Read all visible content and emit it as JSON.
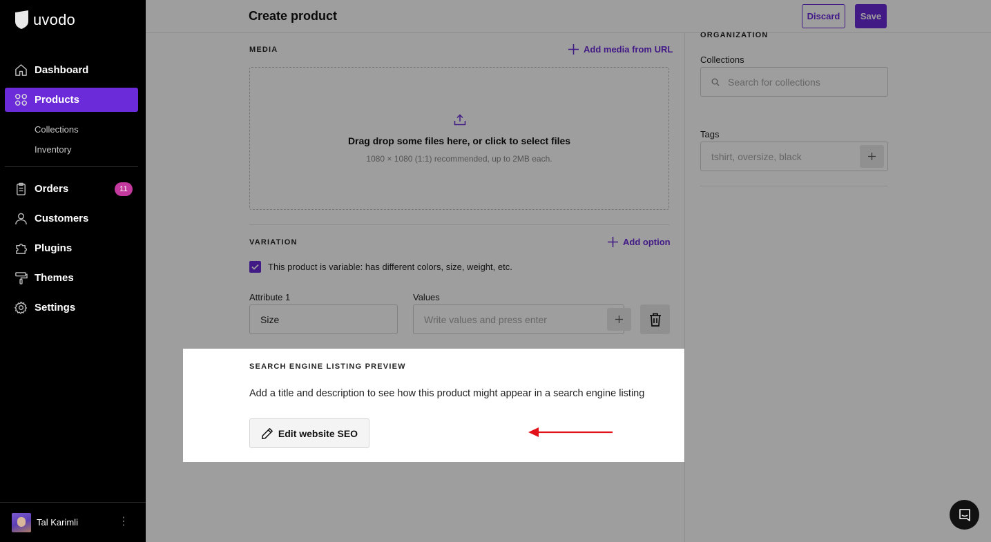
{
  "app": {
    "brand": "uvodo",
    "accent_color": "#6b2bd9",
    "badge_color": "#c4399e"
  },
  "sidebar": {
    "items": [
      {
        "label": "Dashboard",
        "icon": "home-icon"
      },
      {
        "label": "Products",
        "icon": "grid-icon",
        "active": true
      },
      {
        "label": "Orders",
        "icon": "clipboard-icon",
        "badge": "11"
      },
      {
        "label": "Customers",
        "icon": "user-icon"
      },
      {
        "label": "Plugins",
        "icon": "puzzle-icon"
      },
      {
        "label": "Themes",
        "icon": "paint-roller-icon"
      },
      {
        "label": "Settings",
        "icon": "gear-icon"
      }
    ],
    "sub_items": [
      "Collections",
      "Inventory"
    ],
    "user": {
      "name": "Tal Karimli"
    }
  },
  "header": {
    "title": "Create product",
    "discard_label": "Discard",
    "save_label": "Save"
  },
  "media": {
    "title": "MEDIA",
    "add_url_label": "Add media from URL",
    "drop_text": "Drag drop some files here, or click to select files",
    "drop_hint": "1080 × 1080 (1:1) recommended, up to 2MB each."
  },
  "variation": {
    "title": "VARIATION",
    "add_option_label": "Add option",
    "checkbox_label": "This product is variable: has different colors, size, weight, etc.",
    "checkbox_checked": true,
    "attribute_label": "Attribute 1",
    "attribute_value": "Size",
    "values_label": "Values",
    "values_placeholder": "Write values and press enter"
  },
  "seo": {
    "title": "SEARCH ENGINE LISTING PREVIEW",
    "description": "Add a title and description to see how this product might appear in a search engine listing",
    "edit_label": "Edit website SEO"
  },
  "organization": {
    "title": "ORGANIZATION",
    "collections_label": "Collections",
    "collections_placeholder": "Search for collections",
    "tags_label": "Tags",
    "tags_placeholder": "tshirt, oversize, black"
  }
}
